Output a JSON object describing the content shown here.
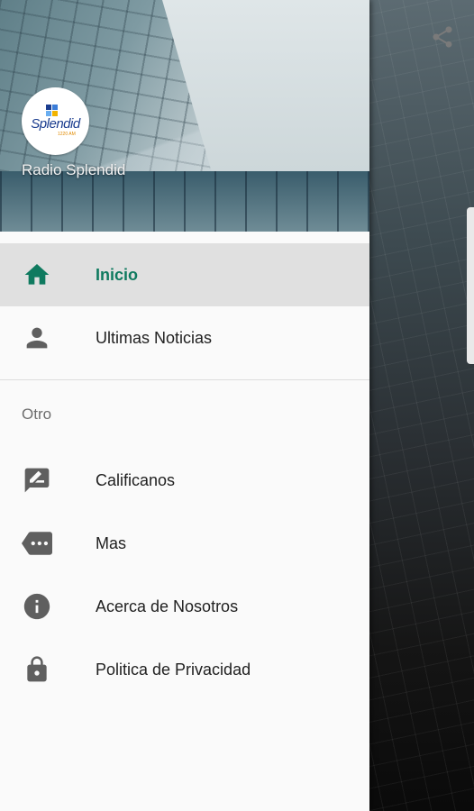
{
  "header": {
    "station_name": "Radio Splendid",
    "logo_text": "Splendid",
    "logo_sub": "1220 AM"
  },
  "menu": {
    "primary": [
      {
        "label": "Inicio",
        "icon": "home-icon",
        "active": true
      },
      {
        "label": "Ultimas Noticias",
        "icon": "person-icon",
        "active": false
      }
    ],
    "section_title": "Otro",
    "secondary": [
      {
        "label": "Calificanos",
        "icon": "rate-review-icon"
      },
      {
        "label": "Mas",
        "icon": "more-label-icon"
      },
      {
        "label": "Acerca de Nosotros",
        "icon": "info-icon"
      },
      {
        "label": "Politica de Privacidad",
        "icon": "lock-icon"
      }
    ]
  },
  "colors": {
    "accent": "#0f7a5f",
    "icon_gray": "#5f5f5f",
    "drawer_bg": "#fafafa",
    "active_row": "#e0e0e0"
  },
  "toolbar": {
    "share_icon": "share-icon"
  }
}
